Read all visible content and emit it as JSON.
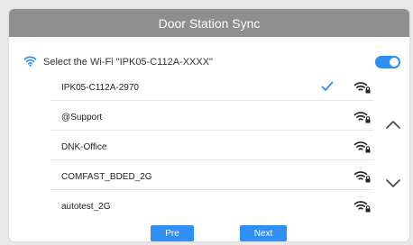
{
  "header": {
    "title": "Door Station Sync"
  },
  "wifi": {
    "prompt": "Select the Wi-Fi \"IPK05-C112A-XXXX\"",
    "toggle_on": true,
    "accent_color": "#2f8ff2",
    "icons": {
      "header": "wifi-icon",
      "signal": "wifi-lock-icon",
      "selected": "check-icon"
    }
  },
  "networks": [
    {
      "ssid": "IPK05-C112A-2970",
      "selected": true
    },
    {
      "ssid": "@Support",
      "selected": false
    },
    {
      "ssid": "DNK-Office",
      "selected": false
    },
    {
      "ssid": "COMFAST_BDED_2G",
      "selected": false
    },
    {
      "ssid": "autotest_2G",
      "selected": false
    }
  ],
  "nav": {
    "up_icon": "chevron-up-icon",
    "down_icon": "chevron-down-icon"
  },
  "buttons": {
    "pre": "Pre",
    "next": "Next"
  }
}
